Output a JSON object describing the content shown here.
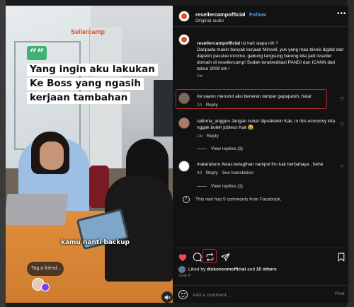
{
  "colors": {
    "accent": "#4aa3f5",
    "like": "#ed4956",
    "highlight": "#b3262b",
    "panel_bg": "#121212"
  },
  "media": {
    "brand_logo": "Sellercamp",
    "quote_mark": "““",
    "headline_lines": [
      "Yang ingin aku lakukan",
      "Ke Boss yang ngasih",
      "kerjaan tambahan"
    ],
    "subtitle": "kamu nanti backup",
    "tag_friend_placeholder": "Tag a friend...",
    "mute_icon": "speaker-muted-icon"
  },
  "header": {
    "username": "resellercampofficial",
    "separator": "•",
    "follow_label": "Follow",
    "audio": "Original audio",
    "more_icon": "•••"
  },
  "comments": [
    {
      "username": "resellercampofficial",
      "text": "Isi hati siapa nih ?\nDaripada makin banyak kerjaan Minsell, yuk yang mau bisnis digital dan dapetin passive income, gabung langsung bareng kita jadi reseller domain di resellercamp! Sudah terakreditasi PANDI dan ICANN dari tahun 2009 loh !",
      "time": "1w",
      "reply_label": ""
    },
    {
      "username": "rie.vaann",
      "text": "menurut aku beneran tampar gapapasih, halal",
      "time": "1h",
      "reply_label": "Reply"
    },
    {
      "username": "rakhma_anggun",
      "text": "Jangan coba² dipraktekin Kak, in this economy kita nggak boleh jobless Kak 😭",
      "time": "1w",
      "reply_label": "Reply",
      "view_replies": "View replies (1)"
    },
    {
      "username": "mataraburn",
      "text": "Awas ketagihan nampol lho kak berbahaya , hehe",
      "time": "4d",
      "reply_label": "Reply",
      "translate_label": "See translation",
      "view_replies": "View replies (1)"
    }
  ],
  "facebook_note": "This reel has 5 comments from Facebook.",
  "likes": {
    "prefix": "Liked by",
    "user": "diskoncomofficial",
    "conjunction": "and",
    "others": "10 others"
  },
  "date": "June 9",
  "add_comment": {
    "placeholder": "Add a comment…",
    "post_label": "Post"
  }
}
